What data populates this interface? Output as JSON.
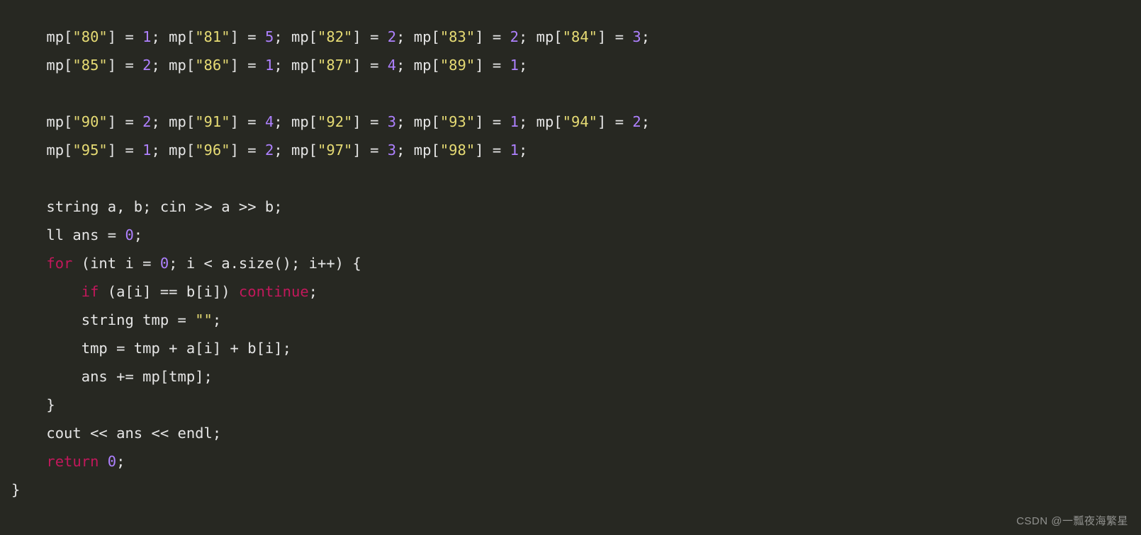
{
  "watermark": "CSDN @一瓢夜海繁星",
  "code": {
    "lines": [
      [
        {
          "t": "    mp[",
          "c": "p"
        },
        {
          "t": "\"80\"",
          "c": "s"
        },
        {
          "t": "] = ",
          "c": "p"
        },
        {
          "t": "1",
          "c": "n"
        },
        {
          "t": "; mp[",
          "c": "p"
        },
        {
          "t": "\"81\"",
          "c": "s"
        },
        {
          "t": "] = ",
          "c": "p"
        },
        {
          "t": "5",
          "c": "n"
        },
        {
          "t": "; mp[",
          "c": "p"
        },
        {
          "t": "\"82\"",
          "c": "s"
        },
        {
          "t": "] = ",
          "c": "p"
        },
        {
          "t": "2",
          "c": "n"
        },
        {
          "t": "; mp[",
          "c": "p"
        },
        {
          "t": "\"83\"",
          "c": "s"
        },
        {
          "t": "] = ",
          "c": "p"
        },
        {
          "t": "2",
          "c": "n"
        },
        {
          "t": "; mp[",
          "c": "p"
        },
        {
          "t": "\"84\"",
          "c": "s"
        },
        {
          "t": "] = ",
          "c": "p"
        },
        {
          "t": "3",
          "c": "n"
        },
        {
          "t": ";",
          "c": "p"
        }
      ],
      [
        {
          "t": "    mp[",
          "c": "p"
        },
        {
          "t": "\"85\"",
          "c": "s"
        },
        {
          "t": "] = ",
          "c": "p"
        },
        {
          "t": "2",
          "c": "n"
        },
        {
          "t": "; mp[",
          "c": "p"
        },
        {
          "t": "\"86\"",
          "c": "s"
        },
        {
          "t": "] = ",
          "c": "p"
        },
        {
          "t": "1",
          "c": "n"
        },
        {
          "t": "; mp[",
          "c": "p"
        },
        {
          "t": "\"87\"",
          "c": "s"
        },
        {
          "t": "] = ",
          "c": "p"
        },
        {
          "t": "4",
          "c": "n"
        },
        {
          "t": "; mp[",
          "c": "p"
        },
        {
          "t": "\"89\"",
          "c": "s"
        },
        {
          "t": "] = ",
          "c": "p"
        },
        {
          "t": "1",
          "c": "n"
        },
        {
          "t": ";",
          "c": "p"
        }
      ],
      [],
      [
        {
          "t": "    mp[",
          "c": "p"
        },
        {
          "t": "\"90\"",
          "c": "s"
        },
        {
          "t": "] = ",
          "c": "p"
        },
        {
          "t": "2",
          "c": "n"
        },
        {
          "t": "; mp[",
          "c": "p"
        },
        {
          "t": "\"91\"",
          "c": "s"
        },
        {
          "t": "] = ",
          "c": "p"
        },
        {
          "t": "4",
          "c": "n"
        },
        {
          "t": "; mp[",
          "c": "p"
        },
        {
          "t": "\"92\"",
          "c": "s"
        },
        {
          "t": "] = ",
          "c": "p"
        },
        {
          "t": "3",
          "c": "n"
        },
        {
          "t": "; mp[",
          "c": "p"
        },
        {
          "t": "\"93\"",
          "c": "s"
        },
        {
          "t": "] = ",
          "c": "p"
        },
        {
          "t": "1",
          "c": "n"
        },
        {
          "t": "; mp[",
          "c": "p"
        },
        {
          "t": "\"94\"",
          "c": "s"
        },
        {
          "t": "] = ",
          "c": "p"
        },
        {
          "t": "2",
          "c": "n"
        },
        {
          "t": ";",
          "c": "p"
        }
      ],
      [
        {
          "t": "    mp[",
          "c": "p"
        },
        {
          "t": "\"95\"",
          "c": "s"
        },
        {
          "t": "] = ",
          "c": "p"
        },
        {
          "t": "1",
          "c": "n"
        },
        {
          "t": "; mp[",
          "c": "p"
        },
        {
          "t": "\"96\"",
          "c": "s"
        },
        {
          "t": "] = ",
          "c": "p"
        },
        {
          "t": "2",
          "c": "n"
        },
        {
          "t": "; mp[",
          "c": "p"
        },
        {
          "t": "\"97\"",
          "c": "s"
        },
        {
          "t": "] = ",
          "c": "p"
        },
        {
          "t": "3",
          "c": "n"
        },
        {
          "t": "; mp[",
          "c": "p"
        },
        {
          "t": "\"98\"",
          "c": "s"
        },
        {
          "t": "] = ",
          "c": "p"
        },
        {
          "t": "1",
          "c": "n"
        },
        {
          "t": ";",
          "c": "p"
        }
      ],
      [],
      [
        {
          "t": "    string a, b; cin >> a >> b;",
          "c": "p"
        }
      ],
      [
        {
          "t": "    ll ans = ",
          "c": "p"
        },
        {
          "t": "0",
          "c": "n"
        },
        {
          "t": ";",
          "c": "p"
        }
      ],
      [
        {
          "t": "    ",
          "c": "p"
        },
        {
          "t": "for",
          "c": "k"
        },
        {
          "t": " (int i = ",
          "c": "p"
        },
        {
          "t": "0",
          "c": "n"
        },
        {
          "t": "; i < a.size(); i++) {",
          "c": "p"
        }
      ],
      [
        {
          "t": "        ",
          "c": "p"
        },
        {
          "t": "if",
          "c": "k"
        },
        {
          "t": " (a[i] == b[i]) ",
          "c": "p"
        },
        {
          "t": "continue",
          "c": "k"
        },
        {
          "t": ";",
          "c": "p"
        }
      ],
      [
        {
          "t": "        string tmp = ",
          "c": "p"
        },
        {
          "t": "\"\"",
          "c": "s"
        },
        {
          "t": ";",
          "c": "p"
        }
      ],
      [
        {
          "t": "        tmp = tmp + a[i] + b[i];",
          "c": "p"
        }
      ],
      [
        {
          "t": "        ans += mp[tmp];",
          "c": "p"
        }
      ],
      [
        {
          "t": "    }",
          "c": "p"
        }
      ],
      [
        {
          "t": "    cout << ans << endl;",
          "c": "p"
        }
      ],
      [
        {
          "t": "    ",
          "c": "p"
        },
        {
          "t": "return",
          "c": "k"
        },
        {
          "t": " ",
          "c": "p"
        },
        {
          "t": "0",
          "c": "n"
        },
        {
          "t": ";",
          "c": "p"
        }
      ],
      [
        {
          "t": "}",
          "c": "p"
        }
      ]
    ]
  }
}
